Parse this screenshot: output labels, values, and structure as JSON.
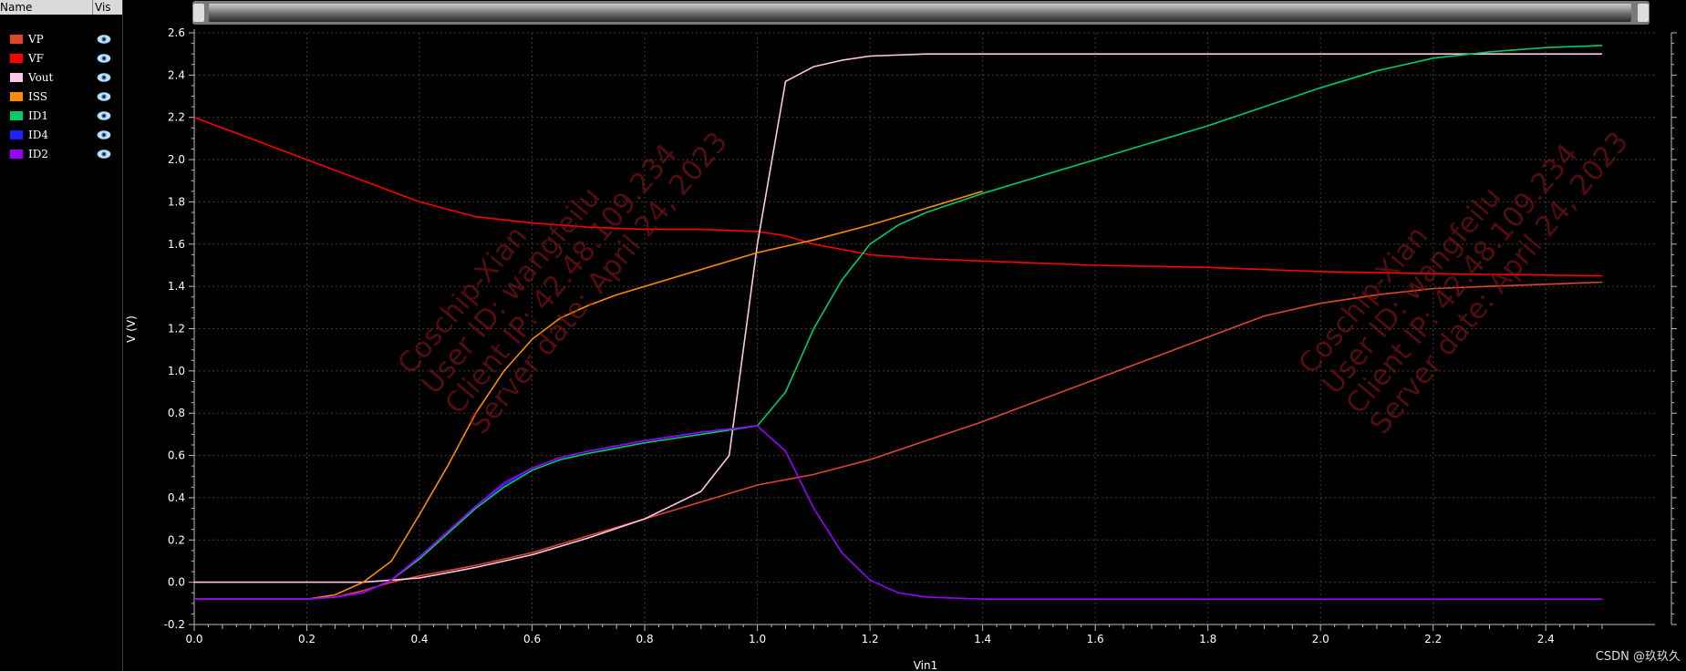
{
  "legend": {
    "header": {
      "name": "Name",
      "vis": "Vis"
    },
    "items": [
      {
        "label": "VP",
        "color": "#e0462a"
      },
      {
        "label": "VF",
        "color": "#ff0000"
      },
      {
        "label": "Vout",
        "color": "#ffc6e8"
      },
      {
        "label": "ISS",
        "color": "#ff8c00"
      },
      {
        "label": "ID1",
        "color": "#00cc66"
      },
      {
        "label": "ID4",
        "color": "#1f1fff"
      },
      {
        "label": "ID2",
        "color": "#9b00ff"
      }
    ]
  },
  "watermark": {
    "lines": [
      "Coschip-Xian",
      "User ID: wangfeilu",
      "Client IP: 42.48.109.234",
      "Server date: April 24, 2023"
    ]
  },
  "credit": "CSDN @玖玖久",
  "chart_data": {
    "type": "line",
    "xlabel": "Vin1",
    "ylabel": "V (V)",
    "xlim": [
      0,
      2.5
    ],
    "ylim": [
      -0.2,
      2.6
    ],
    "x_ticks": [
      "0.0",
      "0.2",
      "0.4",
      "0.6",
      "0.8",
      "1.0",
      "1.2",
      "1.4",
      "1.6",
      "1.8",
      "2.0",
      "2.2",
      "2.4"
    ],
    "y_ticks": [
      "-0.2",
      "0.0",
      "0.2",
      "0.4",
      "0.6",
      "0.8",
      "1.0",
      "1.2",
      "1.4",
      "1.6",
      "1.8",
      "2.0",
      "2.2",
      "2.4",
      "2.6"
    ],
    "grid": true,
    "legend_position": "left panel",
    "series": [
      {
        "name": "VP",
        "color": "#e0462a",
        "points": [
          [
            0,
            -0.08
          ],
          [
            0.2,
            -0.08
          ],
          [
            0.25,
            -0.07
          ],
          [
            0.3,
            -0.04
          ],
          [
            0.35,
            0.0
          ],
          [
            0.4,
            0.03
          ],
          [
            0.5,
            0.08
          ],
          [
            0.6,
            0.14
          ],
          [
            0.7,
            0.22
          ],
          [
            0.8,
            0.3
          ],
          [
            0.9,
            0.38
          ],
          [
            1.0,
            0.46
          ],
          [
            1.1,
            0.51
          ],
          [
            1.2,
            0.58
          ],
          [
            1.3,
            0.67
          ],
          [
            1.4,
            0.76
          ],
          [
            1.5,
            0.86
          ],
          [
            1.6,
            0.96
          ],
          [
            1.7,
            1.06
          ],
          [
            1.8,
            1.16
          ],
          [
            1.9,
            1.26
          ],
          [
            2.0,
            1.32
          ],
          [
            2.1,
            1.36
          ],
          [
            2.2,
            1.39
          ],
          [
            2.3,
            1.4
          ],
          [
            2.4,
            1.41
          ],
          [
            2.5,
            1.42
          ]
        ]
      },
      {
        "name": "VF",
        "color": "#ff0000",
        "points": [
          [
            0,
            2.2
          ],
          [
            0.1,
            2.1
          ],
          [
            0.2,
            2.0
          ],
          [
            0.3,
            1.9
          ],
          [
            0.4,
            1.8
          ],
          [
            0.5,
            1.73
          ],
          [
            0.6,
            1.7
          ],
          [
            0.7,
            1.68
          ],
          [
            0.8,
            1.67
          ],
          [
            0.9,
            1.67
          ],
          [
            1.0,
            1.66
          ],
          [
            1.05,
            1.64
          ],
          [
            1.1,
            1.6
          ],
          [
            1.2,
            1.55
          ],
          [
            1.3,
            1.53
          ],
          [
            1.4,
            1.52
          ],
          [
            1.6,
            1.5
          ],
          [
            1.8,
            1.49
          ],
          [
            2.0,
            1.47
          ],
          [
            2.2,
            1.46
          ],
          [
            2.5,
            1.45
          ]
        ]
      },
      {
        "name": "Vout",
        "color": "#ffc6e8",
        "points": [
          [
            0,
            0.0
          ],
          [
            0.3,
            0.0
          ],
          [
            0.4,
            0.02
          ],
          [
            0.5,
            0.07
          ],
          [
            0.6,
            0.13
          ],
          [
            0.7,
            0.21
          ],
          [
            0.8,
            0.3
          ],
          [
            0.9,
            0.43
          ],
          [
            0.95,
            0.6
          ],
          [
            1.0,
            1.6
          ],
          [
            1.05,
            2.37
          ],
          [
            1.1,
            2.44
          ],
          [
            1.15,
            2.47
          ],
          [
            1.2,
            2.49
          ],
          [
            1.3,
            2.5
          ],
          [
            2.5,
            2.5
          ]
        ]
      },
      {
        "name": "ISS",
        "color": "#ff8c00",
        "points": [
          [
            0,
            -0.08
          ],
          [
            0.2,
            -0.08
          ],
          [
            0.25,
            -0.06
          ],
          [
            0.3,
            0.0
          ],
          [
            0.35,
            0.1
          ],
          [
            0.4,
            0.32
          ],
          [
            0.45,
            0.55
          ],
          [
            0.5,
            0.8
          ],
          [
            0.55,
            1.0
          ],
          [
            0.6,
            1.15
          ],
          [
            0.65,
            1.25
          ],
          [
            0.7,
            1.31
          ],
          [
            0.75,
            1.36
          ],
          [
            0.8,
            1.4
          ],
          [
            0.9,
            1.48
          ],
          [
            1.0,
            1.56
          ],
          [
            1.1,
            1.62
          ],
          [
            1.2,
            1.69
          ],
          [
            1.3,
            1.77
          ],
          [
            1.4,
            1.85
          ]
        ]
      },
      {
        "name": "ID1",
        "color": "#00cc66",
        "points": [
          [
            0,
            -0.08
          ],
          [
            0.2,
            -0.08
          ],
          [
            0.25,
            -0.07
          ],
          [
            0.3,
            -0.05
          ],
          [
            0.35,
            0.01
          ],
          [
            0.4,
            0.11
          ],
          [
            0.45,
            0.23
          ],
          [
            0.5,
            0.35
          ],
          [
            0.55,
            0.45
          ],
          [
            0.6,
            0.53
          ],
          [
            0.65,
            0.58
          ],
          [
            0.7,
            0.61
          ],
          [
            0.8,
            0.66
          ],
          [
            0.9,
            0.7
          ],
          [
            1.0,
            0.74
          ],
          [
            1.05,
            0.9
          ],
          [
            1.1,
            1.2
          ],
          [
            1.15,
            1.43
          ],
          [
            1.2,
            1.6
          ],
          [
            1.25,
            1.69
          ],
          [
            1.3,
            1.75
          ],
          [
            1.4,
            1.84
          ],
          [
            1.5,
            1.92
          ],
          [
            1.6,
            2.0
          ],
          [
            1.7,
            2.08
          ],
          [
            1.8,
            2.16
          ],
          [
            1.9,
            2.25
          ],
          [
            2.0,
            2.34
          ],
          [
            2.1,
            2.42
          ],
          [
            2.2,
            2.48
          ],
          [
            2.3,
            2.51
          ],
          [
            2.4,
            2.53
          ],
          [
            2.5,
            2.54
          ]
        ]
      },
      {
        "name": "ID4",
        "color": "#1f1fff",
        "points": [
          [
            0,
            -0.08
          ],
          [
            0.2,
            -0.08
          ],
          [
            0.25,
            -0.07
          ],
          [
            0.3,
            -0.05
          ],
          [
            0.35,
            0.01
          ],
          [
            0.4,
            0.12
          ],
          [
            0.45,
            0.24
          ],
          [
            0.5,
            0.36
          ],
          [
            0.55,
            0.46
          ],
          [
            0.6,
            0.54
          ],
          [
            0.65,
            0.59
          ],
          [
            0.7,
            0.62
          ],
          [
            0.8,
            0.67
          ],
          [
            0.9,
            0.71
          ],
          [
            1.0,
            0.74
          ]
        ]
      },
      {
        "name": "ID2",
        "color": "#9b00ff",
        "points": [
          [
            0,
            -0.08
          ],
          [
            0.2,
            -0.08
          ],
          [
            0.25,
            -0.07
          ],
          [
            0.3,
            -0.05
          ],
          [
            0.35,
            0.01
          ],
          [
            0.4,
            0.12
          ],
          [
            0.45,
            0.24
          ],
          [
            0.5,
            0.36
          ],
          [
            0.55,
            0.47
          ],
          [
            0.6,
            0.54
          ],
          [
            0.65,
            0.59
          ],
          [
            0.7,
            0.62
          ],
          [
            0.8,
            0.67
          ],
          [
            0.9,
            0.71
          ],
          [
            1.0,
            0.74
          ],
          [
            1.05,
            0.62
          ],
          [
            1.1,
            0.35
          ],
          [
            1.15,
            0.14
          ],
          [
            1.2,
            0.01
          ],
          [
            1.25,
            -0.05
          ],
          [
            1.3,
            -0.07
          ],
          [
            1.4,
            -0.08
          ],
          [
            2.5,
            -0.08
          ]
        ]
      }
    ]
  }
}
